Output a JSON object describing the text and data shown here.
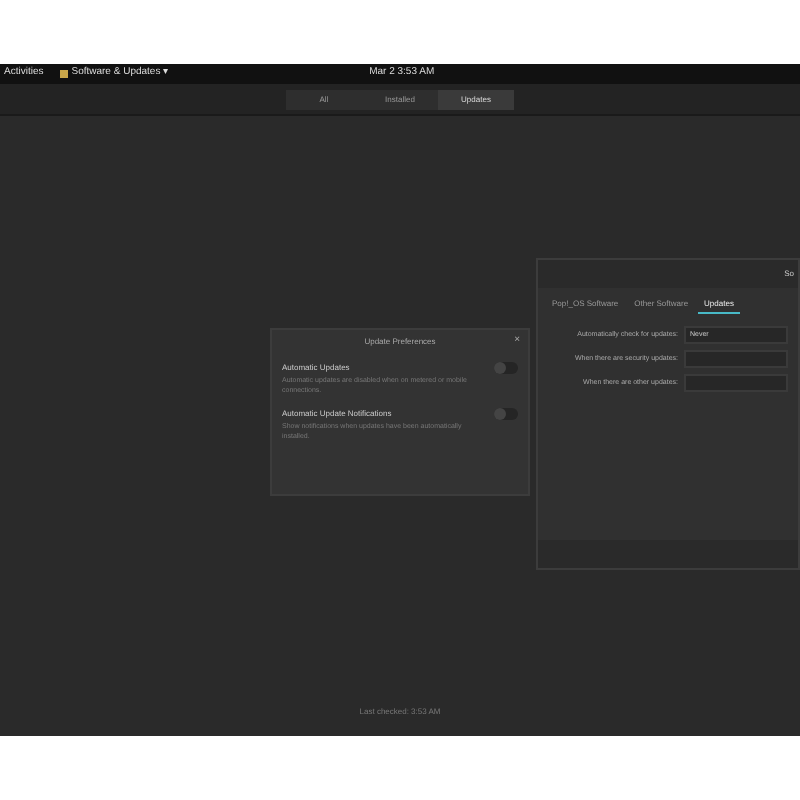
{
  "top_bar": {
    "activities": "Activities",
    "app_menu": "Software & Updates ▾",
    "clock": "Mar 2 3:53 AM"
  },
  "header": {
    "tabs": [
      {
        "label": "All",
        "selected": false
      },
      {
        "label": "Installed",
        "selected": false
      },
      {
        "label": "Updates",
        "selected": true
      }
    ]
  },
  "preferences_dialog": {
    "title": "Update Preferences",
    "close": "×",
    "options": [
      {
        "label": "Automatic Updates",
        "description": "Automatic updates are disabled when on metered or mobile connections.",
        "on": false
      },
      {
        "label": "Automatic Update Notifications",
        "description": "Show notifications when updates have been automatically installed.",
        "on": false
      }
    ]
  },
  "software_window": {
    "title": "So",
    "tabs": [
      {
        "label": "Pop!_OS Software",
        "selected": false
      },
      {
        "label": "Other Software",
        "selected": false
      },
      {
        "label": "Updates",
        "selected": true
      }
    ],
    "rows": [
      {
        "label": "Automatically check for updates:",
        "value": "Never"
      },
      {
        "label": "When there are security updates:",
        "value": ""
      },
      {
        "label": "When there are other updates:",
        "value": ""
      }
    ]
  },
  "status": "Last checked: 3:53 AM"
}
